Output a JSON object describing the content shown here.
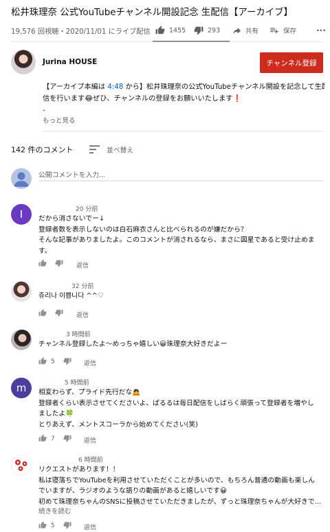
{
  "video": {
    "title": "松井珠理奈 公式YouTubeチャンネル開設記念 生配信【アーカイブ】",
    "view_info": "19,576 回視聴・2020/11/01 にライブ配信",
    "like_count": "1455",
    "dislike_count": "293",
    "share_label": "共有",
    "save_label": "保存"
  },
  "channel": {
    "name": "Jurina HOUSE",
    "subscribe_label": "チャンネル登録"
  },
  "description": {
    "line1_pre": "【アーカイブ本編は ",
    "line1_ts": "4:48",
    "line1_post": " から】松井珠理奈の公式YouTubeチャンネル開設を記念して生配",
    "line2": "信を行います😂ぜひ、チャンネルの登録をお願いいたします❗",
    "line3": "-",
    "show_more": "もっと見る"
  },
  "comments_header": {
    "count": "142 件のコメント",
    "sort_label": "並べ替え"
  },
  "add_comment": {
    "placeholder": "公開コメントを入力..."
  },
  "comments": [
    {
      "avatar_letter": "I",
      "avatar_color": "#6a3bc2",
      "time": "20 分前",
      "lines": [
        "だから消さないでー↓",
        "登録者数を表示しないのは白石麻衣さんと比べられるのが嫌だから？",
        "そんな記事がありましたよ。このコメントが消されるなら、まさに図星であると受け止めま",
        "す。"
      ],
      "like_count": "",
      "reply_label": "返信"
    },
    {
      "time": "32 分前",
      "lines": [
        "쥬리나 이쁩니다 ^^♡"
      ],
      "like_count": "",
      "reply_label": "返信"
    },
    {
      "time": "3 時間前",
      "lines": [
        "チャンネル登録したよ〜めっちゃ嬉しい😀珠理奈大好きだよー"
      ],
      "like_count": "5",
      "reply_label": "返信"
    },
    {
      "avatar_letter": "m",
      "avatar_color": "#4a3f9c",
      "time": "5 時間前",
      "lines": [
        "相変わらず、プライド先行だな🙇",
        "登録者くらい表示させてくださいよ、ぱるるは毎日配信をしばらく頑張って登録者を増やし",
        "ましたよ🍀",
        "とりあえず、メントスコーラから始めてください(笑)"
      ],
      "like_count": "7",
      "reply_label": "返信"
    },
    {
      "time": "6 時間前",
      "lines": [
        "リクエストがあります！！",
        "私は寝落ちでYouTubeを利用させていただくことが多いので、もちろん普通の動画も楽しん",
        "でいますが、ラジオのような語りの動画があると嬉しいです😀",
        "初めて珠理奈ちゃんのSNSに投稿させていただきましたが、ずっと珠理奈ちゃんが大好きで..."
      ],
      "read_more": "続きを読む",
      "like_count": "5",
      "reply_label": "返信"
    }
  ]
}
